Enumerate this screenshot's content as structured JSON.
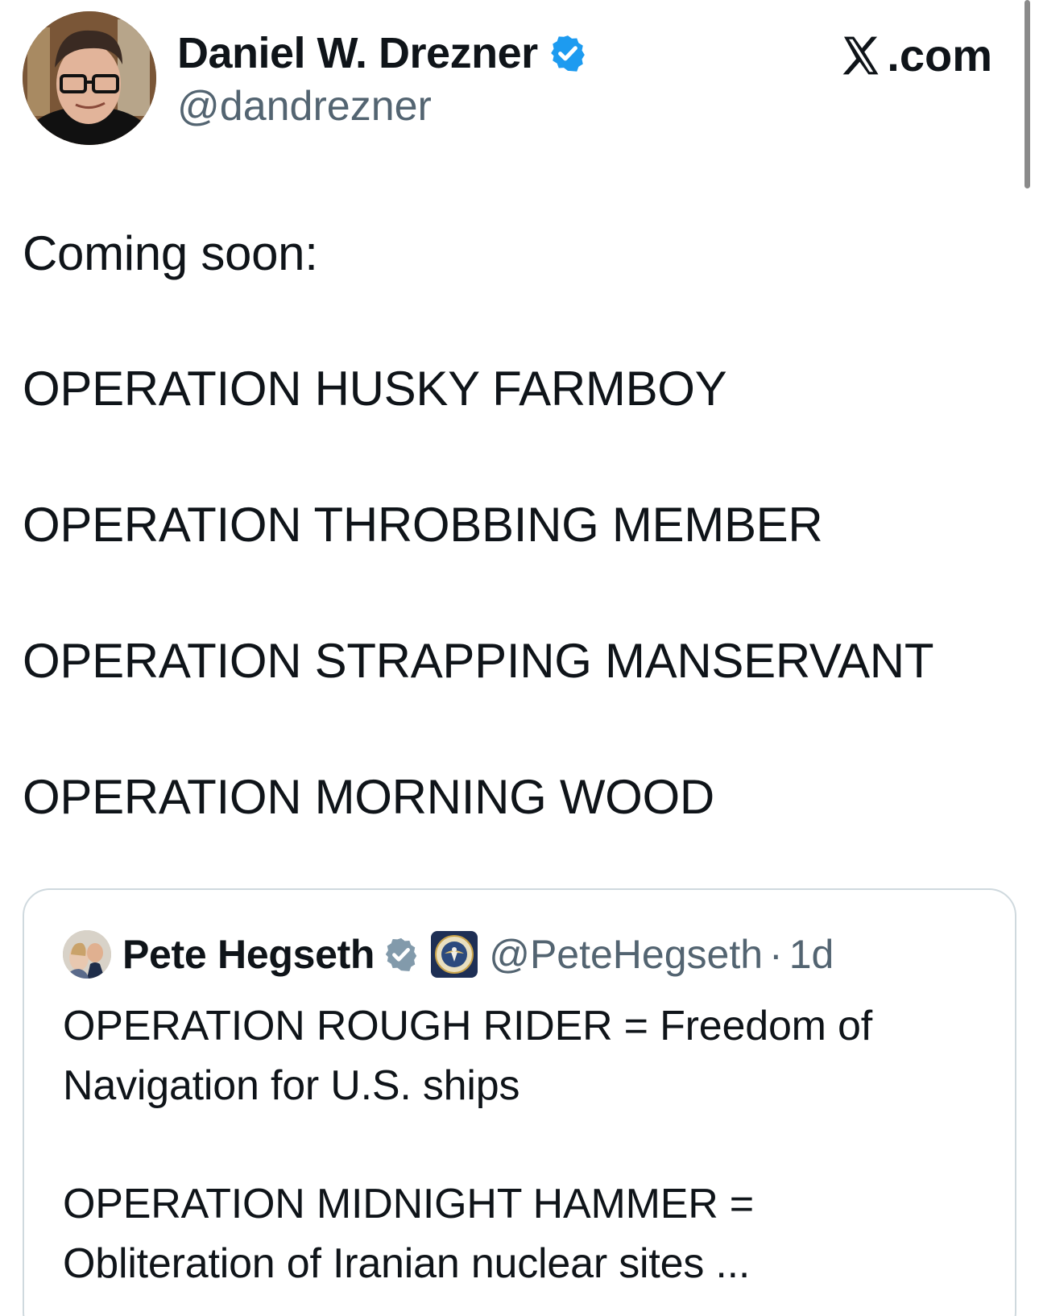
{
  "author": {
    "display_name": "Daniel W. Drezner",
    "handle": "@dandrezner",
    "verified_icon": "verified-badge-icon",
    "verified_color": "#1d9bf0"
  },
  "brand": {
    "label": ".com",
    "icon": "x-logo-icon"
  },
  "tweet": {
    "lines": [
      "Coming soon:",
      "OPERATION HUSKY FARMBOY",
      "OPERATION THROBBING MEMBER",
      "OPERATION STRAPPING MANSERVANT",
      "OPERATION MORNING WOOD"
    ]
  },
  "quoted_tweet": {
    "display_name": "Pete Hegseth",
    "verified_icon": "verified-badge-icon",
    "verified_color": "#829aab",
    "affiliation_icon": "department-seal-icon",
    "handle": "@PeteHegseth",
    "separator": "·",
    "time": "1d",
    "paragraph_1": [
      "OPERATION ROUGH RIDER = Freedom of",
      "Navigation for U.S. ships"
    ],
    "paragraph_2": [
      "OPERATION MIDNIGHT HAMMER =",
      "Obliteration of Iranian nuclear sites ..."
    ]
  },
  "colors": {
    "text": "#0f1419",
    "secondary": "#536471",
    "border": "#cfd9de"
  }
}
